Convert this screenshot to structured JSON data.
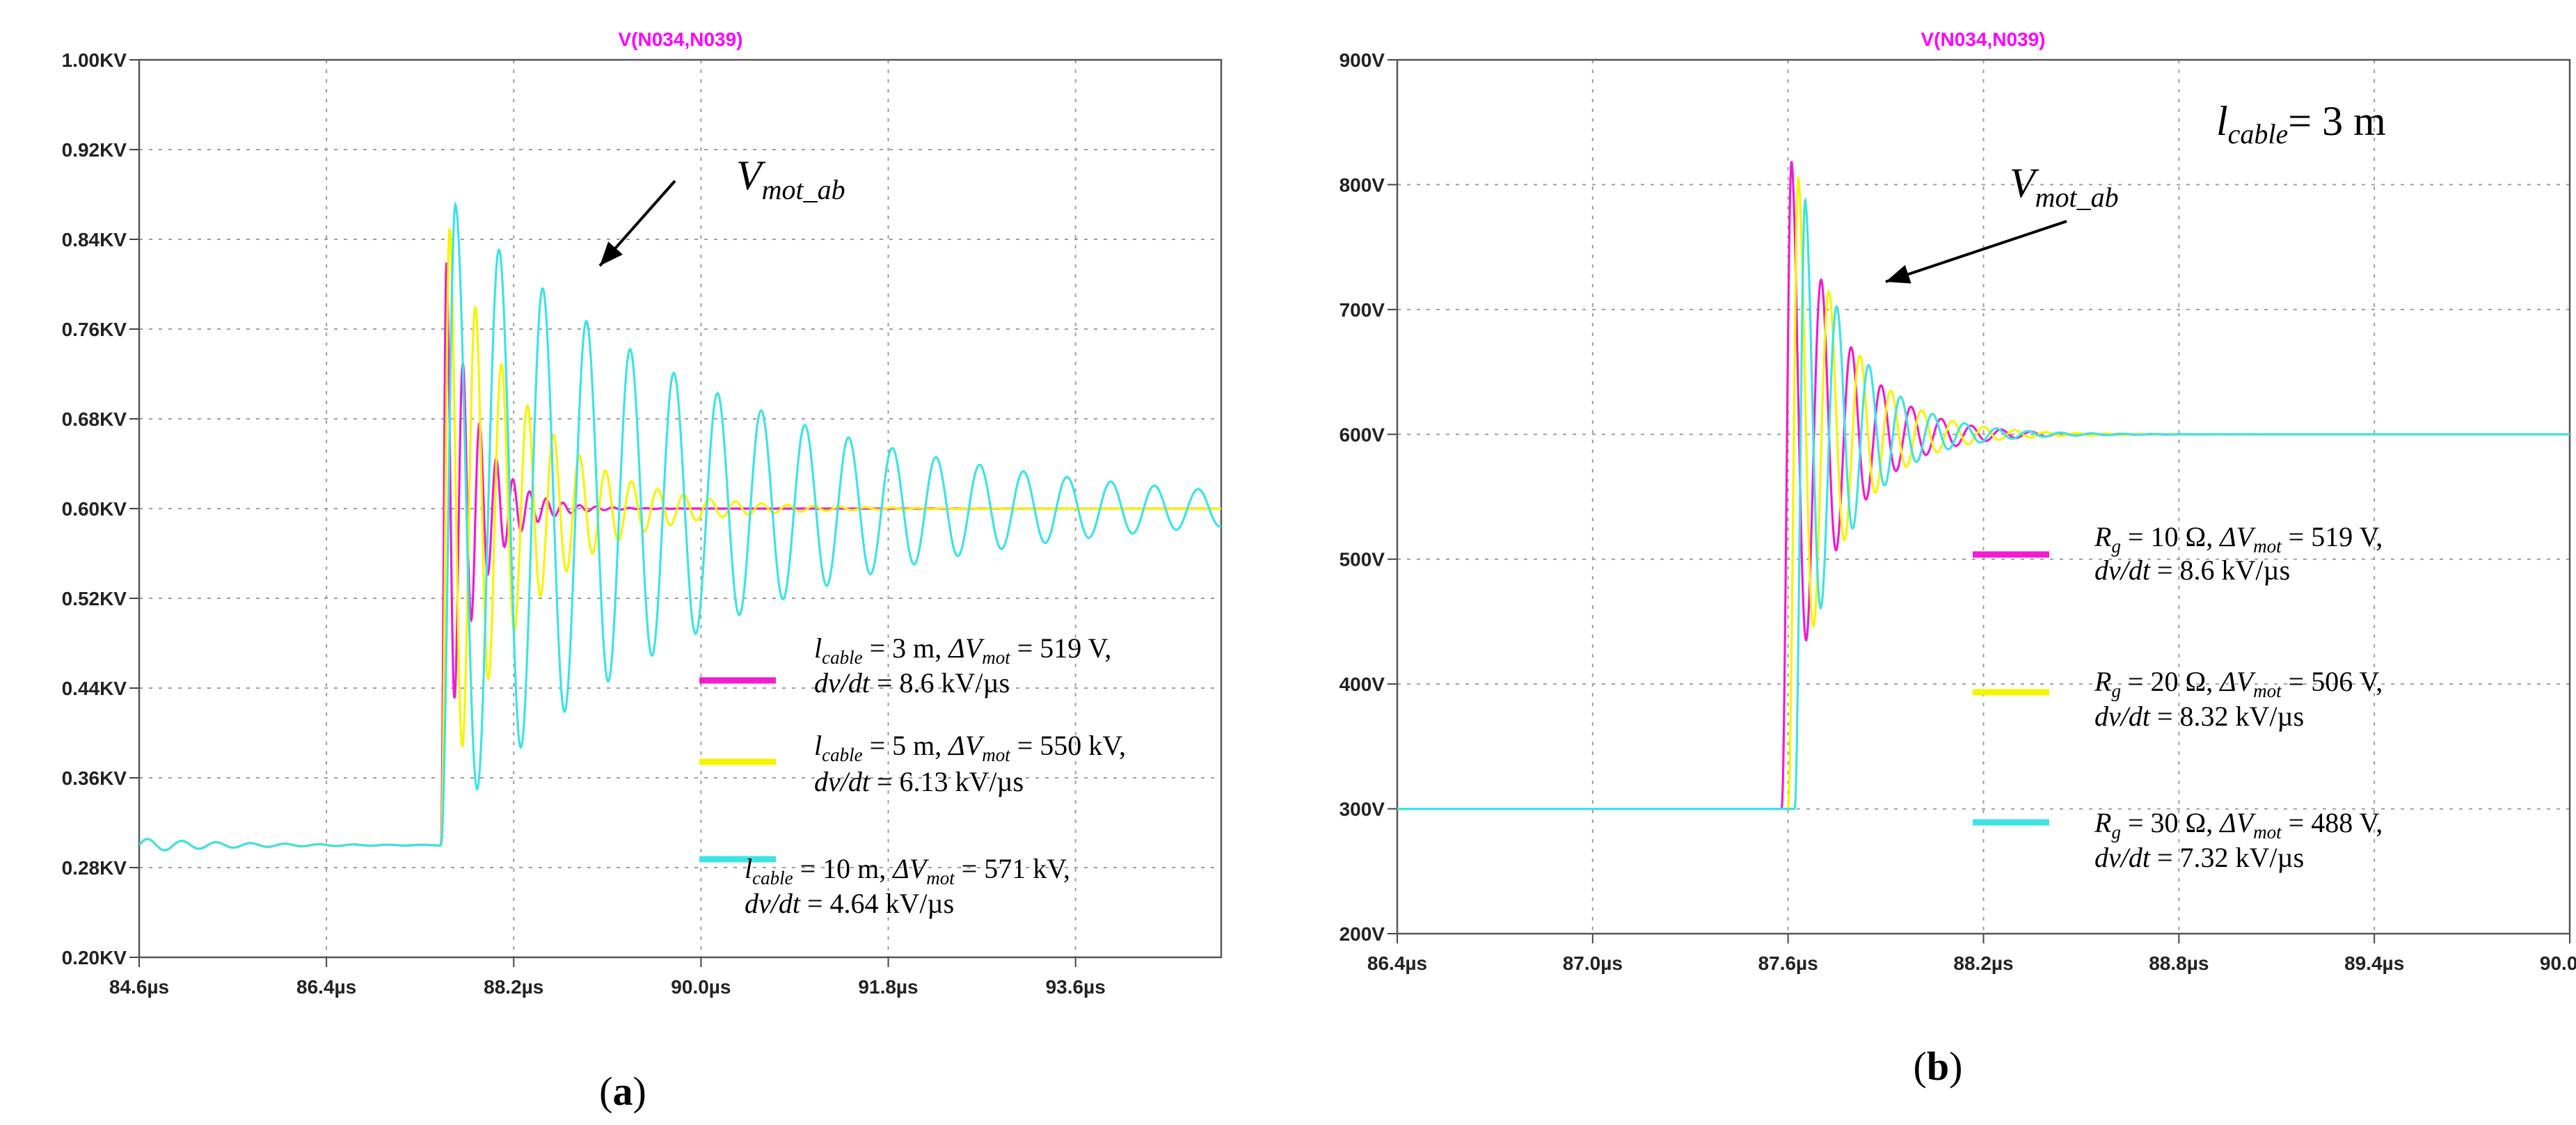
{
  "colors": {
    "magenta": "#f21bd2",
    "yellow": "#f5f500",
    "cyan": "#3ee3e3",
    "grid": "#9e9e9e",
    "title": "#ff00ff"
  },
  "chart_data": [
    {
      "type": "line",
      "panel_label": "(a)",
      "title": "V(N034,N039)",
      "x_ticks": [
        "84.6µs",
        "86.4µs",
        "88.2µs",
        "90.0µs",
        "91.8µs",
        "93.6µs"
      ],
      "y_ticks": [
        "1.00KV",
        "0.92KV",
        "0.84KV",
        "0.76KV",
        "0.68KV",
        "0.60KV",
        "0.52KV",
        "0.44KV",
        "0.36KV",
        "0.28KV",
        "0.20KV"
      ],
      "xlim_us": [
        84.6,
        95.0
      ],
      "ylim_V": [
        200,
        1000
      ],
      "annotation": {
        "base": "V",
        "sub": "mot_ab"
      },
      "series": [
        {
          "color_key": "magenta",
          "start_us": 87.5,
          "v0": 300,
          "vf": 600,
          "peak": 820,
          "period_us": 0.16,
          "tau_us": 0.3,
          "legend": [
            {
              "base": "l",
              "sub": "cable",
              "rest": " = 3 m, ",
              "dbase": "ΔV",
              "dsub": "mot",
              "drest": " = 519 V,"
            },
            {
              "dvdt": "dv/dt",
              "rest": " = 8.6 kV/µs"
            }
          ]
        },
        {
          "color_key": "yellow",
          "start_us": 87.5,
          "v0": 300,
          "vf": 600,
          "peak": 850,
          "period_us": 0.25,
          "tau_us": 0.75,
          "legend": [
            {
              "base": "l",
              "sub": "cable",
              "rest": " = 5 m, ",
              "dbase": "ΔV",
              "dsub": "mot",
              "drest": " = 550 kV,"
            },
            {
              "dvdt": "dv/dt",
              "rest": " = 6.13 kV/µs"
            }
          ]
        },
        {
          "color_key": "cyan",
          "start_us": 87.5,
          "v0": 300,
          "vf": 600,
          "peak": 871,
          "period_us": 0.42,
          "tau_us": 2.6,
          "legend": [
            {
              "base": "l",
              "sub": "cable",
              "rest": " = 10 m, ",
              "dbase": "ΔV",
              "dsub": "mot",
              "drest": " = 571 kV,"
            },
            {
              "dvdt": "dv/dt",
              "rest": " = 4.64 kV/µs"
            }
          ]
        }
      ]
    },
    {
      "type": "line",
      "panel_label": "(b)",
      "title": "V(N034,N039)",
      "x_ticks": [
        "86.4µs",
        "87.0µs",
        "87.6µs",
        "88.2µs",
        "88.8µs",
        "89.4µs",
        "90.0µs"
      ],
      "y_ticks": [
        "900V",
        "800V",
        "700V",
        "600V",
        "500V",
        "400V",
        "300V",
        "200V"
      ],
      "xlim_us": [
        86.4,
        90.0
      ],
      "ylim_V": [
        200,
        900
      ],
      "annotation": {
        "base": "V",
        "sub": "mot_ab"
      },
      "cable_note": {
        "base": "l",
        "sub": "cable",
        "rest": "= 3 m"
      },
      "series": [
        {
          "color_key": "magenta",
          "start_us": 87.58,
          "v0": 300,
          "vf": 600,
          "peak": 819,
          "period_us": 0.092,
          "tau_us": 0.16,
          "legend": [
            {
              "base": "R",
              "sub": "g",
              "rest": " = 10 Ω, ",
              "dbase": "ΔV",
              "dsub": "mot",
              "drest": " = 519 V,"
            },
            {
              "dvdt": "dv/dt",
              "rest": " = 8.6 kV/µs"
            }
          ]
        },
        {
          "color_key": "yellow",
          "start_us": 87.6,
          "v0": 300,
          "vf": 600,
          "peak": 806,
          "period_us": 0.095,
          "tau_us": 0.16,
          "legend": [
            {
              "base": "R",
              "sub": "g",
              "rest": " = 20 Ω, ",
              "dbase": "ΔV",
              "dsub": "mot",
              "drest": " = 506 V,"
            },
            {
              "dvdt": "dv/dt",
              "rest": " = 8.32 kV/µs"
            }
          ]
        },
        {
          "color_key": "cyan",
          "start_us": 87.62,
          "v0": 300,
          "vf": 600,
          "peak": 788,
          "period_us": 0.098,
          "tau_us": 0.16,
          "legend": [
            {
              "base": "R",
              "sub": "g",
              "rest": " = 30 Ω, ",
              "dbase": "ΔV",
              "dsub": "mot",
              "drest": " = 488 V,"
            },
            {
              "dvdt": "dv/dt",
              "rest": " = 7.32 kV/µs"
            }
          ]
        }
      ]
    }
  ]
}
